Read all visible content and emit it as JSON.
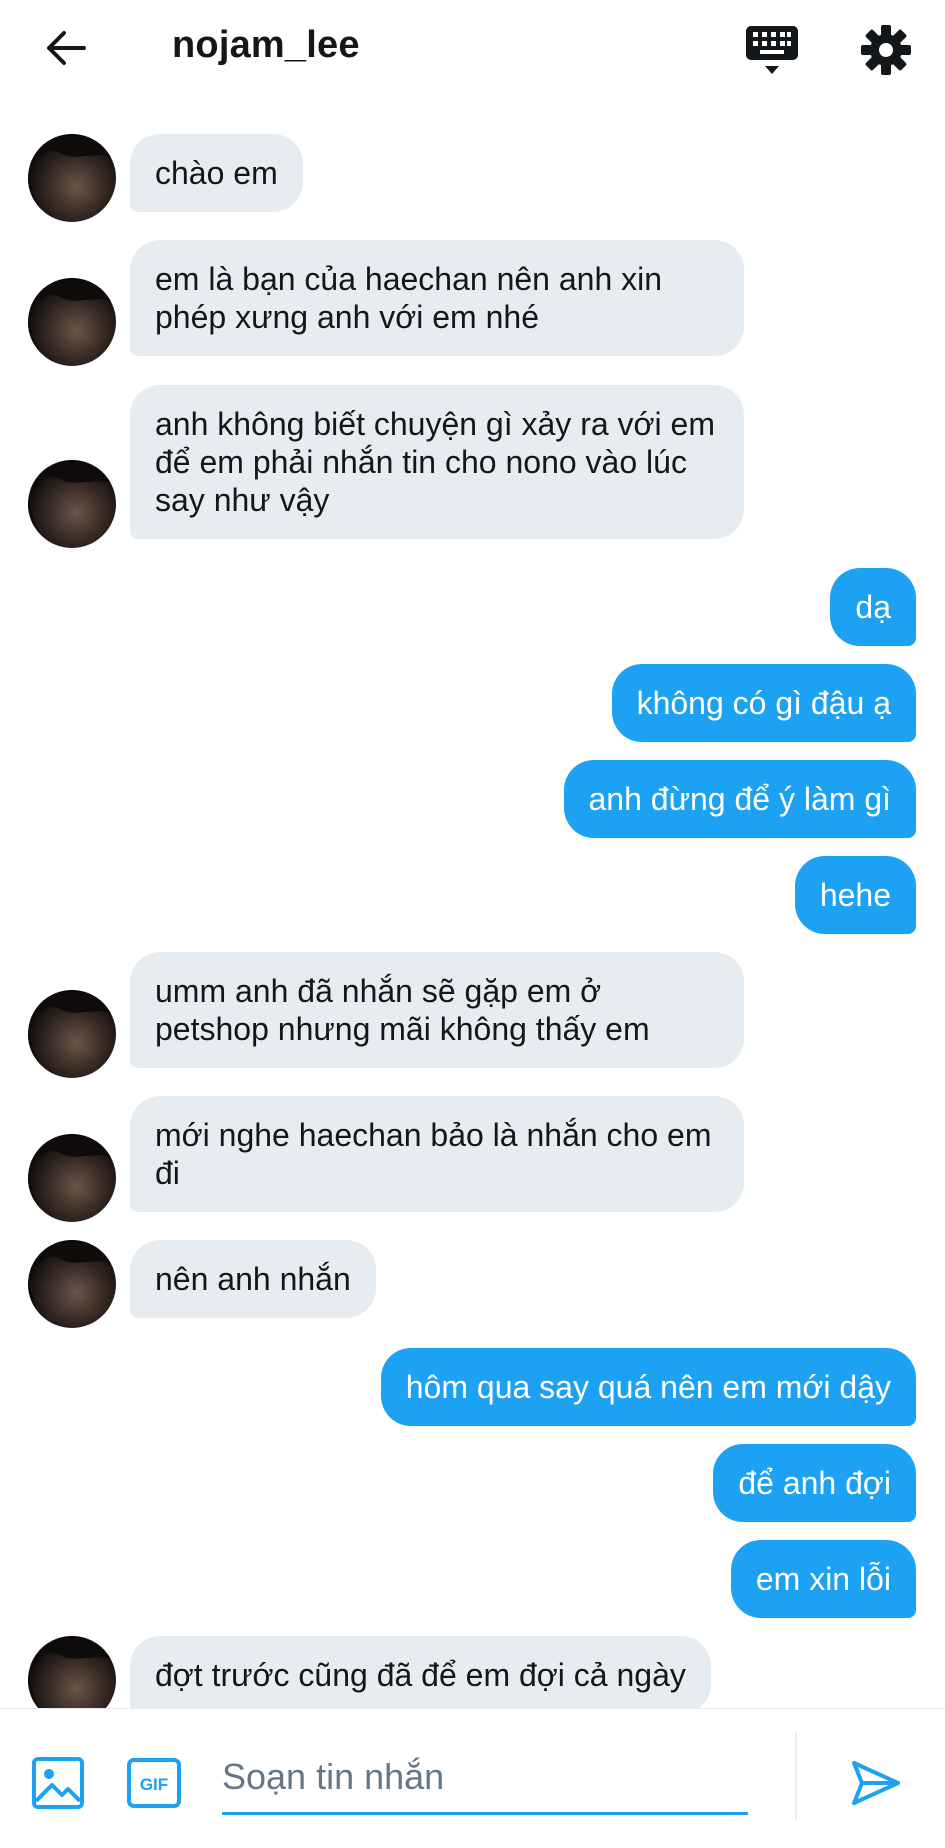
{
  "header": {
    "title": "nojam_lee",
    "back_icon": "arrow-left-icon",
    "keyboard_icon": "keyboard-icon",
    "settings_icon": "gear-icon"
  },
  "messages": [
    {
      "from": "received",
      "text": "chào em",
      "avatar": true
    },
    {
      "from": "received",
      "text": "em là bạn của haechan nên anh xin phép xưng anh với em nhé",
      "avatar": true
    },
    {
      "from": "received",
      "text": "anh không biết chuyện gì xảy ra với em để em phải nhắn tin cho nono vào lúc say như vậy",
      "avatar": true
    },
    {
      "from": "sent",
      "text": "dạ"
    },
    {
      "from": "sent",
      "text": "không có gì đậu ạ"
    },
    {
      "from": "sent",
      "text": "anh đừng để ý làm gì"
    },
    {
      "from": "sent",
      "text": "hehe"
    },
    {
      "from": "received",
      "text": "umm anh đã nhắn sẽ gặp em ở petshop nhưng mãi không thấy em",
      "avatar": true
    },
    {
      "from": "received",
      "text": "mới nghe haechan bảo là nhắn cho em đi",
      "avatar": true
    },
    {
      "from": "received",
      "text": "nên anh nhắn",
      "avatar": true
    },
    {
      "from": "sent",
      "text": "hôm qua say quá nên em mới dậy"
    },
    {
      "from": "sent",
      "text": "để anh đợi"
    },
    {
      "from": "sent",
      "text": "em xin lỗi"
    },
    {
      "from": "received",
      "text": "đợt trước cũng đã để em đợi cả ngày",
      "avatar": true
    }
  ],
  "composer": {
    "placeholder": "Soạn tin nhắn",
    "gif_label": "GIF",
    "image_icon": "image-icon",
    "send_icon": "send-icon"
  },
  "colors": {
    "accent": "#1da1f2",
    "received_bubble": "#e6ecf0",
    "text": "#14171a",
    "placeholder": "#657786"
  }
}
